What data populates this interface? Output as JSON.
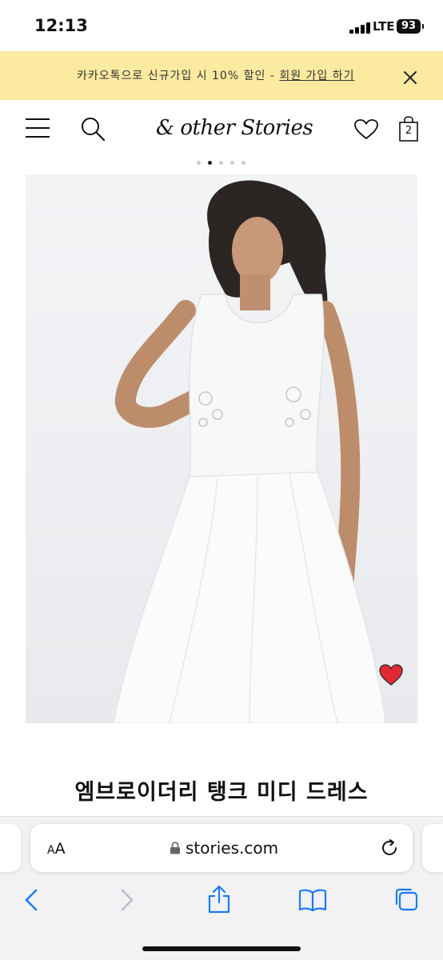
{
  "status_bar": {
    "time": "12:13",
    "network": "LTE",
    "battery": "93"
  },
  "promo": {
    "text": "카카오톡으로 신규가입 시 10% 할인 - ",
    "link_label": "회원 가입 하기"
  },
  "header": {
    "logo": "& other Stories",
    "bag_count": "2"
  },
  "carousel": {
    "total": 5,
    "active_index": 1
  },
  "product": {
    "title": "엠브로이더리 탱크 미디 드레스",
    "wishlisted": true
  },
  "browser": {
    "text_size_label_small": "A",
    "text_size_label_large": "A",
    "url": "stories.com"
  },
  "colors": {
    "promo_bg": "#fbeaa0",
    "heart": "#e02a36",
    "ios_blue": "#1a7cf5"
  }
}
